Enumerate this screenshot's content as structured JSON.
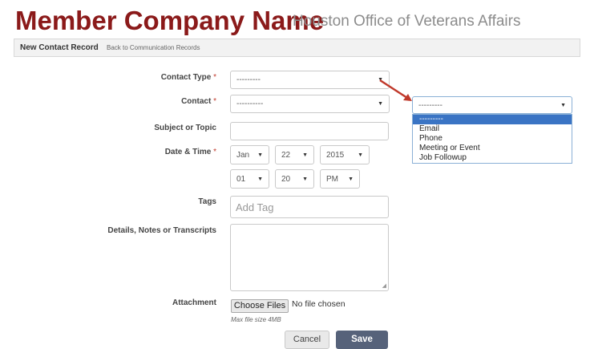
{
  "header": {
    "company_name": "Member Company Name",
    "office_name": "Houston Office of Veterans Affairs"
  },
  "breadcrumb": {
    "title": "New Contact Record",
    "back_link": "Back to Communication Records"
  },
  "form": {
    "required_marker": "*",
    "contact_type": {
      "label": "Contact Type",
      "value": "---------"
    },
    "contact": {
      "label": "Contact",
      "value": "----------"
    },
    "subject": {
      "label": "Subject or Topic",
      "value": ""
    },
    "datetime": {
      "label": "Date & Time",
      "month": "Jan",
      "day": "22",
      "year": "2015",
      "hour": "01",
      "minute": "20",
      "ampm": "PM"
    },
    "tags": {
      "label": "Tags",
      "placeholder": "Add Tag"
    },
    "details": {
      "label": "Details, Notes or Transcripts",
      "value": ""
    },
    "attachment": {
      "label": "Attachment",
      "button": "Choose Files",
      "status": "No file chosen",
      "hint": "Max file size 4MB"
    },
    "cancel": "Cancel",
    "save": "Save"
  },
  "dropdown_callout": {
    "selected": "---------",
    "options": [
      "---------",
      "Email",
      "Phone",
      "Meeting or Event",
      "Job Followup"
    ]
  },
  "colors": {
    "brand": "#8b1a1a",
    "arrow": "#c0392b",
    "save_button": "#56627a",
    "highlight": "#3a74c4"
  },
  "icons": {
    "select_arrow": "chevron-down-icon",
    "callout_arrow": "red-arrow-icon",
    "resize": "resize-grip-icon"
  }
}
